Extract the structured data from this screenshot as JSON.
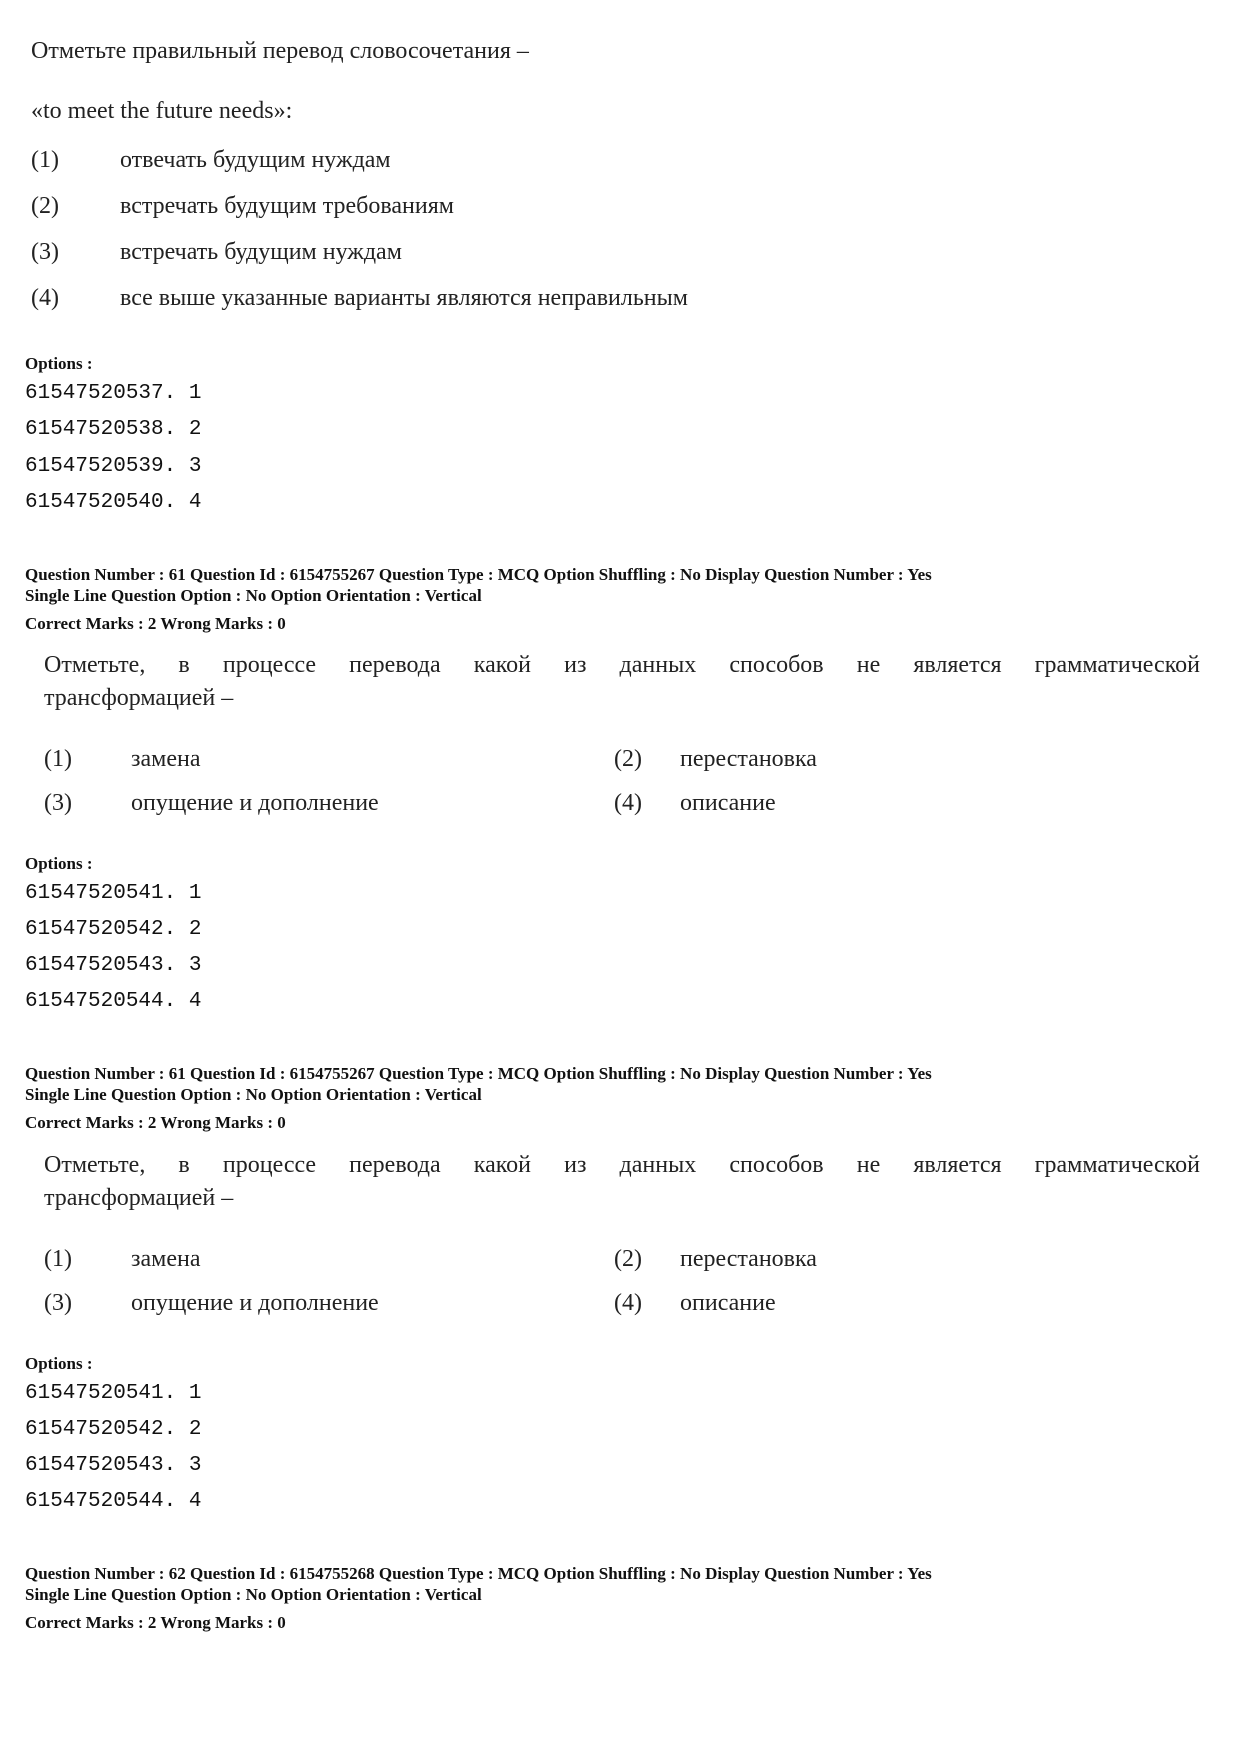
{
  "block1": {
    "question_line1": "Отметьте правильный перевод словосочетания –",
    "question_line2": "«to meet the future needs»:",
    "choices": [
      {
        "num": "(1)",
        "text": "отвечать будущим нуждам"
      },
      {
        "num": "(2)",
        "text": "встречать будущим требованиям"
      },
      {
        "num": "(3)",
        "text": "встречать будущим нуждам"
      },
      {
        "num": "(4)",
        "text": "все выше указанные варианты являются неправильным"
      }
    ],
    "options_label": "Options :",
    "options": [
      "61547520537. 1",
      "61547520538. 2",
      "61547520539. 3",
      "61547520540. 4"
    ]
  },
  "block2": {
    "meta_line1": "Question Number : 61  Question Id : 6154755267  Question Type : MCQ  Option Shuffling : No  Display Question Number : Yes",
    "meta_line2": "Single Line Question Option : No  Option Orientation : Vertical",
    "marks": "Correct Marks : 2  Wrong Marks : 0",
    "question_line1": "Отметьте, в процессе перевода какой из данных способов не является грамматической",
    "question_line2": "трансформацией –",
    "choices": [
      {
        "num": "(1)",
        "text": "замена"
      },
      {
        "num": "(2)",
        "text": "перестановка"
      },
      {
        "num": "(3)",
        "text": "опущение и дополнение"
      },
      {
        "num": "(4)",
        "text": "описание"
      }
    ],
    "options_label": "Options :",
    "options": [
      "61547520541. 1",
      "61547520542. 2",
      "61547520543. 3",
      "61547520544. 4"
    ]
  },
  "block3": {
    "meta_line1": "Question Number : 61  Question Id : 6154755267  Question Type : MCQ  Option Shuffling : No  Display Question Number : Yes",
    "meta_line2": "Single Line Question Option : No  Option Orientation : Vertical",
    "marks": "Correct Marks : 2  Wrong Marks : 0",
    "question_line1": "Отметьте, в процессе перевода какой из данных способов не является грамматической",
    "question_line2": "трансформацией –",
    "choices": [
      {
        "num": "(1)",
        "text": "замена"
      },
      {
        "num": "(2)",
        "text": "перестановка"
      },
      {
        "num": "(3)",
        "text": "опущение и дополнение"
      },
      {
        "num": "(4)",
        "text": "описание"
      }
    ],
    "options_label": "Options :",
    "options": [
      "61547520541. 1",
      "61547520542. 2",
      "61547520543. 3",
      "61547520544. 4"
    ]
  },
  "block4": {
    "meta_line1": "Question Number : 62  Question Id : 6154755268  Question Type : MCQ  Option Shuffling : No  Display Question Number : Yes",
    "meta_line2": "Single Line Question Option : No  Option Orientation : Vertical",
    "marks": "Correct Marks : 2  Wrong Marks : 0"
  }
}
